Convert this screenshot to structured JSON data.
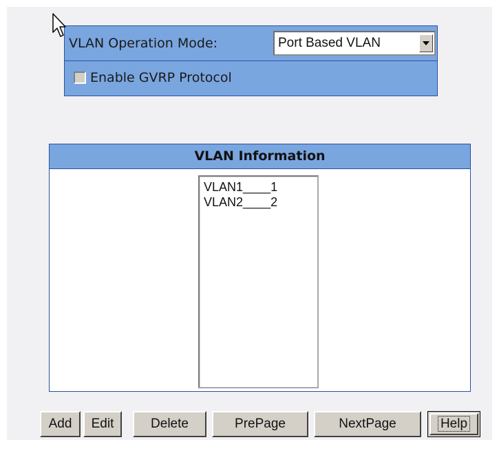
{
  "config": {
    "mode_label": "VLAN Operation Mode:",
    "mode_value": "Port Based VLAN",
    "gvrp_label": "Enable GVRP Protocol",
    "gvrp_checked": false
  },
  "info": {
    "title": "VLAN Information",
    "items": [
      "VLAN1____1",
      "VLAN2____2"
    ]
  },
  "buttons": {
    "add": "Add",
    "edit": "Edit",
    "delete": "Delete",
    "prepage": "PrePage",
    "nextpage": "NextPage",
    "help": "Help"
  }
}
